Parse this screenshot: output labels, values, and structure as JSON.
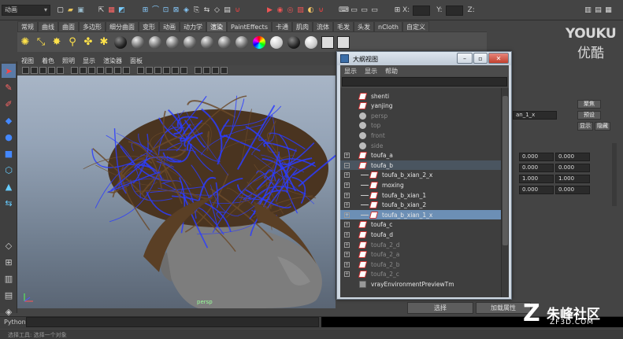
{
  "statusline": {
    "menu_set": "动画",
    "x_label": "X:",
    "y_label": "Y:",
    "z_label": "Z:"
  },
  "shelf": {
    "tabs": [
      "常规",
      "曲线",
      "曲面",
      "多边形",
      "细分曲面",
      "变形",
      "动画",
      "动力学",
      "渲染",
      "PaintEffects",
      "卡通",
      "肌肉",
      "流体",
      "毛发",
      "头发",
      "nCloth",
      "自定义"
    ],
    "active_tab": "渲染"
  },
  "viewport": {
    "menu": [
      "视图",
      "着色",
      "照明",
      "显示",
      "渲染器",
      "面板"
    ],
    "camera_label": "persp"
  },
  "outliner": {
    "title": "大纲视图",
    "menu": [
      "显示",
      "显示",
      "帮助"
    ],
    "items": [
      {
        "label": "shenti",
        "icon": "xform-icon",
        "expand": "",
        "indent": 0,
        "dim": false,
        "state": ""
      },
      {
        "label": "yanjing",
        "icon": "xform-icon",
        "expand": "",
        "indent": 0,
        "dim": false,
        "state": ""
      },
      {
        "label": "persp",
        "icon": "camera-icon",
        "expand": "",
        "indent": 0,
        "dim": true,
        "state": ""
      },
      {
        "label": "top",
        "icon": "camera-icon",
        "expand": "",
        "indent": 0,
        "dim": true,
        "state": ""
      },
      {
        "label": "front",
        "icon": "camera-icon",
        "expand": "",
        "indent": 0,
        "dim": true,
        "state": ""
      },
      {
        "label": "side",
        "icon": "camera-icon",
        "expand": "",
        "indent": 0,
        "dim": true,
        "state": ""
      },
      {
        "label": "toufa_a",
        "icon": "xform-icon",
        "expand": "+",
        "indent": 0,
        "dim": false,
        "state": ""
      },
      {
        "label": "toufa_b",
        "icon": "xform-icon",
        "expand": "−",
        "indent": 0,
        "dim": false,
        "state": "hl"
      },
      {
        "label": "toufa_b_xian_2_x",
        "icon": "xform-icon",
        "expand": "+",
        "indent": 1,
        "dim": false,
        "state": ""
      },
      {
        "label": "moxing",
        "icon": "xform-icon",
        "expand": "+",
        "indent": 1,
        "dim": false,
        "state": ""
      },
      {
        "label": "toufa_b_xian_1",
        "icon": "xform-icon",
        "expand": "+",
        "indent": 1,
        "dim": false,
        "state": ""
      },
      {
        "label": "toufa_b_xian_2",
        "icon": "xform-icon",
        "expand": "+",
        "indent": 1,
        "dim": false,
        "state": ""
      },
      {
        "label": "toufa_b_xian_1_x",
        "icon": "xform-icon",
        "expand": "+",
        "indent": 1,
        "dim": false,
        "state": "sel"
      },
      {
        "label": "toufa_c",
        "icon": "xform-icon",
        "expand": "+",
        "indent": 0,
        "dim": false,
        "state": ""
      },
      {
        "label": "toufa_d",
        "icon": "xform-icon",
        "expand": "+",
        "indent": 0,
        "dim": false,
        "state": ""
      },
      {
        "label": "toufa_2_d",
        "icon": "xform-icon",
        "expand": "+",
        "indent": 0,
        "dim": true,
        "state": ""
      },
      {
        "label": "toufa_2_a",
        "icon": "xform-icon",
        "expand": "+",
        "indent": 0,
        "dim": true,
        "state": ""
      },
      {
        "label": "toufa_2_b",
        "icon": "xform-icon",
        "expand": "+",
        "indent": 0,
        "dim": true,
        "state": ""
      },
      {
        "label": "toufa_2_c",
        "icon": "xform-icon",
        "expand": "+",
        "indent": 0,
        "dim": true,
        "state": ""
      },
      {
        "label": "vrayEnvironmentPreviewTm",
        "icon": "cube-icon",
        "expand": "",
        "indent": 0,
        "dim": false,
        "state": ""
      }
    ]
  },
  "attribute_editor": {
    "buttons": [
      "聚焦",
      "预设",
      "显示",
      "隐藏"
    ],
    "node_suffix": "an_1_x",
    "values": [
      [
        "0.000",
        "0.000"
      ],
      [
        "0.000",
        "0.000"
      ],
      [
        "1.000",
        "1.000"
      ],
      [
        "0.000",
        "0.000"
      ]
    ]
  },
  "bottom_buttons": {
    "select": "选择",
    "load_attrs": "加载属性"
  },
  "cmdline": {
    "python_label": "Python"
  },
  "helpline": {
    "text": "选择工具: 选择一个对象"
  },
  "watermarks": {
    "youku": "YOUKU",
    "youku_cn": "优酷",
    "zf_cn": "朱峰社区",
    "zf_url": "ZF3D.COM"
  },
  "colors": {
    "selection_blue": "#6c8fb5",
    "viewport_top": "#a8b5c6",
    "hair_blue": "#2b3cff",
    "hair_brown": "#6b4a2a"
  }
}
